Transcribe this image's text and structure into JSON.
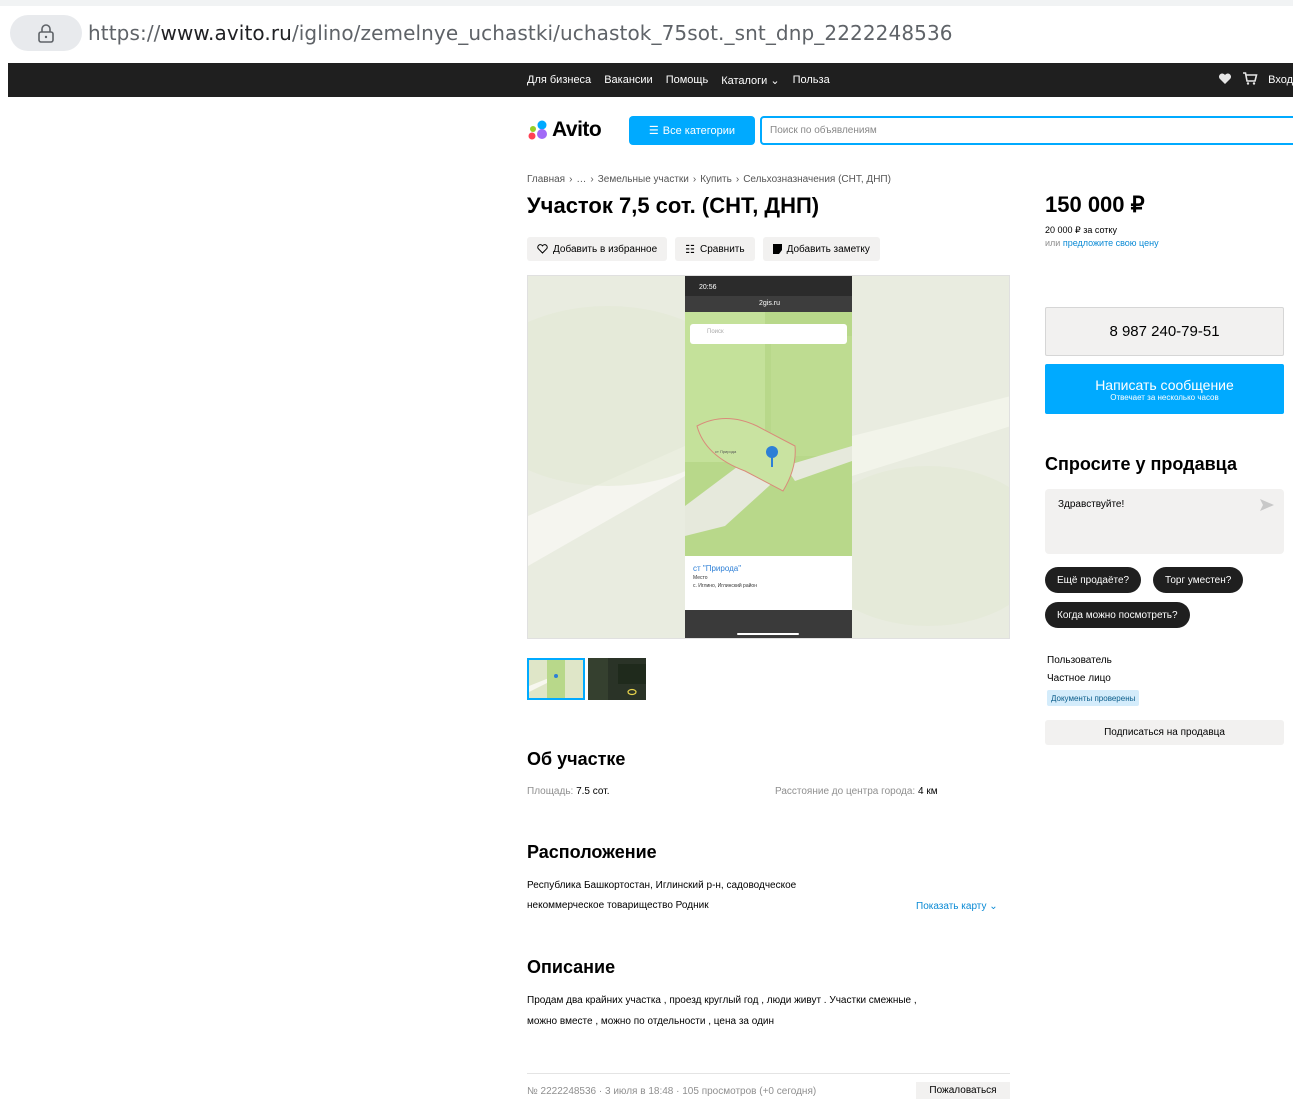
{
  "browser": {
    "url_prefix": "https://",
    "url_host": "www.avito.ru",
    "url_path": "/iglino/zemelnye_uchastki/uchastok_75sot._snt_dnp_2222248536"
  },
  "topnav": {
    "items": [
      "Для бизнеса",
      "Вакансии",
      "Помощь",
      "Каталоги",
      "Польза"
    ],
    "login": "Вход"
  },
  "header": {
    "logo": "Avito",
    "categories_button": "Все категории",
    "search_placeholder": "Поиск по объявлениям"
  },
  "breadcrumb": [
    "Главная",
    "…",
    "Земельные участки",
    "Купить",
    "Сельхозназначения (СНТ, ДНП)"
  ],
  "listing": {
    "title": "Участок 7,5 сот. (СНТ, ДНП)",
    "actions": {
      "favorite": "Добавить в избранное",
      "compare": "Сравнить",
      "note": "Добавить заметку"
    },
    "photo": {
      "status_time": "20:56",
      "site": "2gis.ru",
      "search_hint": "Поиск",
      "map_label": "ст Природа",
      "place_title": "ст \"Природа\"",
      "place_type": "Место",
      "place_address": "с. Иглино, Иглинский район"
    }
  },
  "about": {
    "heading": "Об участке",
    "area_label": "Площадь:",
    "area_value": "7.5 сот.",
    "distance_label": "Расстояние до центра города:",
    "distance_value": "4 км"
  },
  "location": {
    "heading": "Расположение",
    "line1": "Республика Башкортостан, Иглинский р-н, садоводческое",
    "line2": "некоммерческое товарищество Родник",
    "map_link": "Показать карту"
  },
  "description": {
    "heading": "Описание",
    "line1": "Продам два крайних участка , проезд круглый год , люди живут . Участки смежные ,",
    "line2": "можно вместе , можно по отдельности , цена за один"
  },
  "footer": {
    "meta": "№ 2222248536 · 3 июля в 18:48 · 105 просмотров (+0 сегодня)",
    "complain": "Пожаловаться"
  },
  "sidebar": {
    "price": "150 000 ₽",
    "per_unit": "20 000 ₽ за сотку",
    "offer_prefix": "или",
    "offer_link": "предложите свою цену",
    "phone": "8 987 240-79-51",
    "message_button": "Написать сообщение",
    "message_sub": "Отвечает за несколько часов",
    "ask_heading": "Спросите у продавца",
    "ask_text": "Здравствуйте!",
    "chips": [
      "Ещё продаёте?",
      "Торг уместен?",
      "Когда можно посмотреть?"
    ],
    "seller_name": "Пользователь",
    "seller_type": "Частное лицо",
    "verified_badge": "Документы проверены",
    "subscribe": "Подписаться на продавца"
  },
  "colors": {
    "accent": "#00aaff",
    "link": "#0a8ad5",
    "dark": "#1f1f1f",
    "button_bg": "#f2f1f0"
  }
}
